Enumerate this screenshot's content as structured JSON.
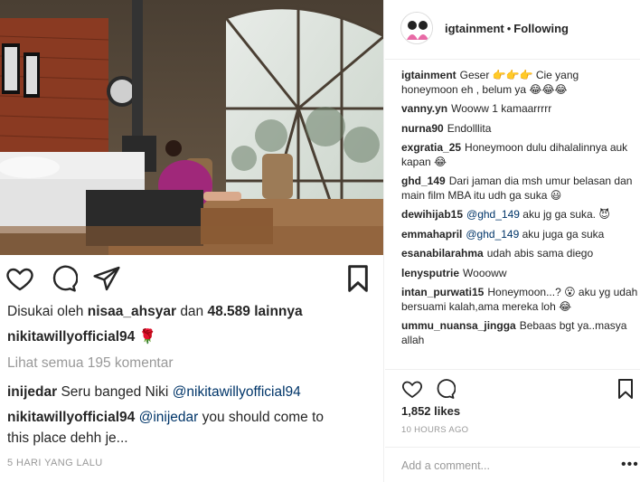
{
  "left_post": {
    "liked_by_prefix": "Disukai oleh",
    "liked_by_user": "nisaa_ahsyar",
    "liked_by_and": "dan",
    "liked_by_count": "48.589 lainnya",
    "author": "nikitawillyofficial94",
    "author_caption_emoji": "🌹",
    "view_all": "Lihat semua 195 komentar",
    "comments": [
      {
        "user": "inijedar",
        "text": "Seru banged Niki",
        "mention": "@nikitawillyofficial94",
        "after": ""
      },
      {
        "user": "nikitawillyofficial94",
        "text": "",
        "mention": "@inijedar",
        "after": "you should come to"
      },
      {
        "user": "",
        "text": "this place dehh je...",
        "mention": "",
        "after": ""
      }
    ],
    "timestamp": "5 HARI YANG LALU",
    "icons": [
      "heart-icon",
      "comment-icon",
      "share-icon",
      "bookmark-icon"
    ]
  },
  "right_post": {
    "username": "igtainment",
    "separator": "•",
    "follow_status": "Following",
    "comments": [
      {
        "user": "igtainment",
        "text": "Geser 👉👉👉 Cie yang honeymoon eh , belum ya 😂😂😂"
      },
      {
        "user": "vanny.yn",
        "text": "Wooww 1 kamaarrrrr"
      },
      {
        "user": "nurna90",
        "text": "Endolllita"
      },
      {
        "user": "exgratia_25",
        "text": "Honeymoon dulu dihalalinnya auk kapan 😂"
      },
      {
        "user": "ghd_149",
        "text": "Dari jaman dia msh umur belasan dan main film MBA itu udh ga suka 😃"
      },
      {
        "user": "dewihijab15",
        "mention": "@ghd_149",
        "text": "aku jg ga suka. 😈"
      },
      {
        "user": "emmahapril",
        "mention": "@ghd_149",
        "text": "aku juga ga suka"
      },
      {
        "user": "esanabilarahma",
        "text": "udah abis sama diego"
      },
      {
        "user": "lenysputrie",
        "text": "Woooww"
      },
      {
        "user": "intan_purwati15",
        "text": "Honeymoon...? 😮 aku yg udah bersuami kalah,ama mereka loh 😂"
      },
      {
        "user": "ummu_nuansa_jingga",
        "text": "Bebaas bgt ya..masya allah"
      }
    ],
    "likes": "1,852 likes",
    "time": "10 HOURS AGO",
    "add_comment_placeholder": "Add a comment...",
    "more_label": "•••",
    "icons": [
      "heart-icon",
      "comment-icon",
      "bookmark-icon",
      "more-options-icon"
    ]
  },
  "colors": {
    "text": "#262626",
    "muted": "#999999",
    "mention": "#003569",
    "border": "#efefef",
    "robe": "#a0287a"
  }
}
